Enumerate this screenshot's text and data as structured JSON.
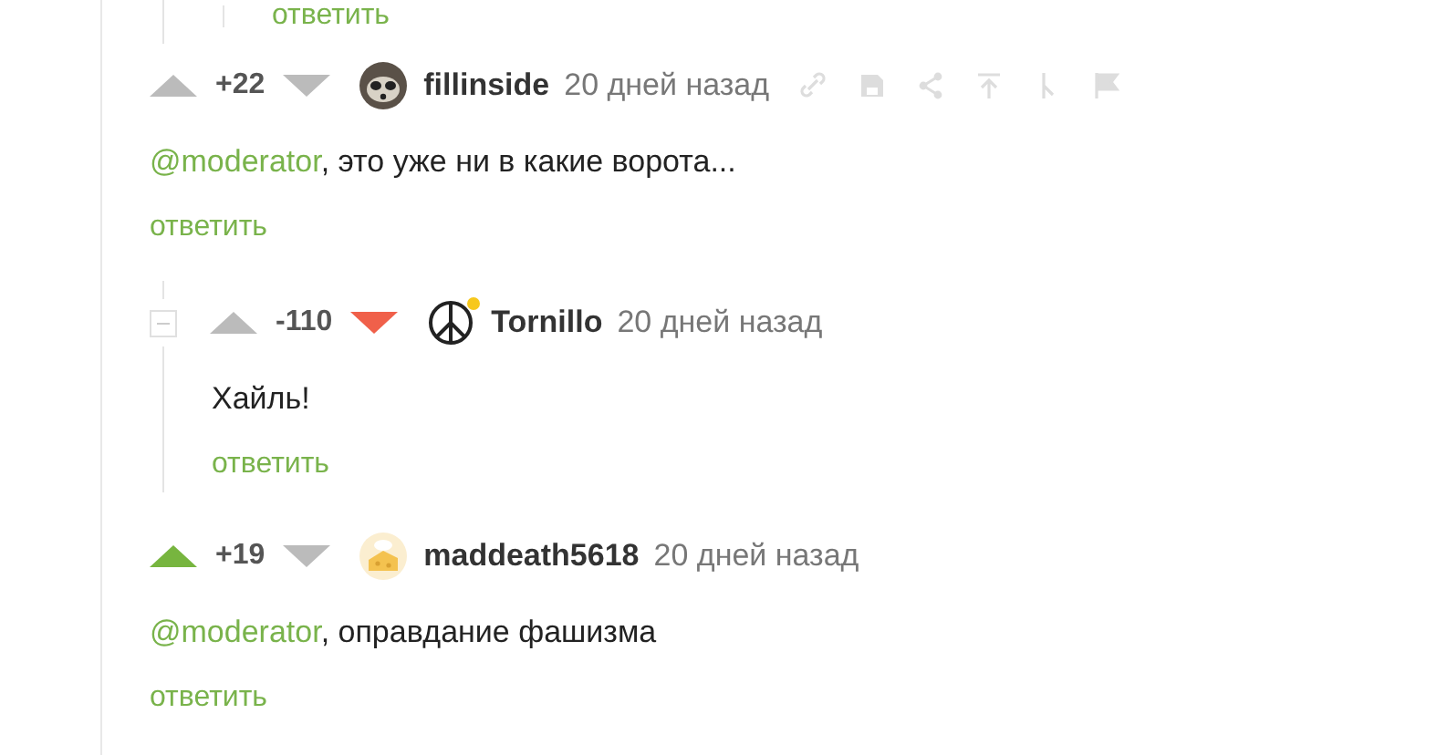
{
  "top_stub": {
    "reply": "ответить"
  },
  "comments": [
    {
      "score": "+22",
      "up_selected": false,
      "down_selected": false,
      "author": "fillinside",
      "time": "20 дней назад",
      "actions": true,
      "collapsible": false,
      "online": false,
      "text": "@moderator,  это уже ни в какие ворота...",
      "mention": true,
      "reply": "ответить",
      "children": [
        {
          "score": "-110",
          "up_selected": false,
          "down_selected": true,
          "author": "Tornillo",
          "time": "20 дней назад",
          "actions": false,
          "collapsible": true,
          "online": true,
          "text": "Хайль!",
          "mention": false,
          "reply": "ответить"
        }
      ]
    },
    {
      "score": "+19",
      "up_selected": true,
      "down_selected": false,
      "author": "maddeath5618",
      "time": "20 дней назад",
      "actions": false,
      "collapsible": false,
      "online": false,
      "text": "@moderator, оправдание фашизма",
      "mention": true,
      "reply": "ответить"
    }
  ]
}
